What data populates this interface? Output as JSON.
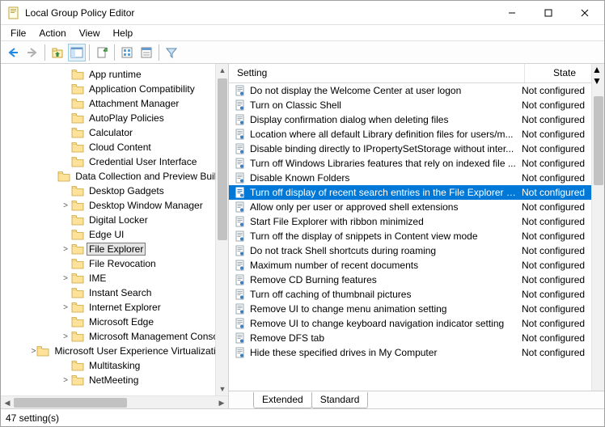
{
  "window_title": "Local Group Policy Editor",
  "menu": {
    "file": "File",
    "action": "Action",
    "view": "View",
    "help": "Help"
  },
  "tree": [
    {
      "label": "App runtime",
      "indent": 70,
      "exp": ""
    },
    {
      "label": "Application Compatibility",
      "indent": 70,
      "exp": ""
    },
    {
      "label": "Attachment Manager",
      "indent": 70,
      "exp": ""
    },
    {
      "label": "AutoPlay Policies",
      "indent": 70,
      "exp": ""
    },
    {
      "label": "Calculator",
      "indent": 70,
      "exp": ""
    },
    {
      "label": "Cloud Content",
      "indent": 70,
      "exp": ""
    },
    {
      "label": "Credential User Interface",
      "indent": 70,
      "exp": ""
    },
    {
      "label": "Data Collection and Preview Builds",
      "indent": 70,
      "exp": ""
    },
    {
      "label": "Desktop Gadgets",
      "indent": 70,
      "exp": ""
    },
    {
      "label": "Desktop Window Manager",
      "indent": 70,
      "exp": ">"
    },
    {
      "label": "Digital Locker",
      "indent": 70,
      "exp": ""
    },
    {
      "label": "Edge UI",
      "indent": 70,
      "exp": ""
    },
    {
      "label": "File Explorer",
      "indent": 70,
      "exp": ">",
      "selected": true
    },
    {
      "label": "File Revocation",
      "indent": 70,
      "exp": ""
    },
    {
      "label": "IME",
      "indent": 70,
      "exp": ">"
    },
    {
      "label": "Instant Search",
      "indent": 70,
      "exp": ""
    },
    {
      "label": "Internet Explorer",
      "indent": 70,
      "exp": ">"
    },
    {
      "label": "Microsoft Edge",
      "indent": 70,
      "exp": ""
    },
    {
      "label": "Microsoft Management Console",
      "indent": 70,
      "exp": ">"
    },
    {
      "label": "Microsoft User Experience Virtualization",
      "indent": 70,
      "exp": ">"
    },
    {
      "label": "Multitasking",
      "indent": 70,
      "exp": ""
    },
    {
      "label": "NetMeeting",
      "indent": 70,
      "exp": ">"
    }
  ],
  "list_header": {
    "setting": "Setting",
    "state": "State"
  },
  "list": [
    {
      "setting": "Do not display the Welcome Center at user logon",
      "state": "Not configured"
    },
    {
      "setting": "Turn on Classic Shell",
      "state": "Not configured"
    },
    {
      "setting": "Display confirmation dialog when deleting files",
      "state": "Not configured"
    },
    {
      "setting": "Location where all default Library definition files for users/m...",
      "state": "Not configured"
    },
    {
      "setting": "Disable binding directly to IPropertySetStorage without inter...",
      "state": "Not configured"
    },
    {
      "setting": "Turn off Windows Libraries features that rely on indexed file ...",
      "state": "Not configured"
    },
    {
      "setting": "Disable Known Folders",
      "state": "Not configured"
    },
    {
      "setting": "Turn off display of recent search entries in the File Explorer s...",
      "state": "Not configured",
      "selected": true
    },
    {
      "setting": "Allow only per user or approved shell extensions",
      "state": "Not configured"
    },
    {
      "setting": "Start File Explorer with ribbon minimized",
      "state": "Not configured"
    },
    {
      "setting": "Turn off the display of snippets in Content view mode",
      "state": "Not configured"
    },
    {
      "setting": "Do not track Shell shortcuts during roaming",
      "state": "Not configured"
    },
    {
      "setting": "Maximum number of recent documents",
      "state": "Not configured"
    },
    {
      "setting": "Remove CD Burning features",
      "state": "Not configured"
    },
    {
      "setting": "Turn off caching of thumbnail pictures",
      "state": "Not configured"
    },
    {
      "setting": "Remove UI to change menu animation setting",
      "state": "Not configured"
    },
    {
      "setting": "Remove UI to change keyboard navigation indicator setting",
      "state": "Not configured"
    },
    {
      "setting": "Remove DFS tab",
      "state": "Not configured"
    },
    {
      "setting": "Hide these specified drives in My Computer",
      "state": "Not configured"
    }
  ],
  "tabs": {
    "extended": "Extended",
    "standard": "Standard"
  },
  "status": "47 setting(s)"
}
